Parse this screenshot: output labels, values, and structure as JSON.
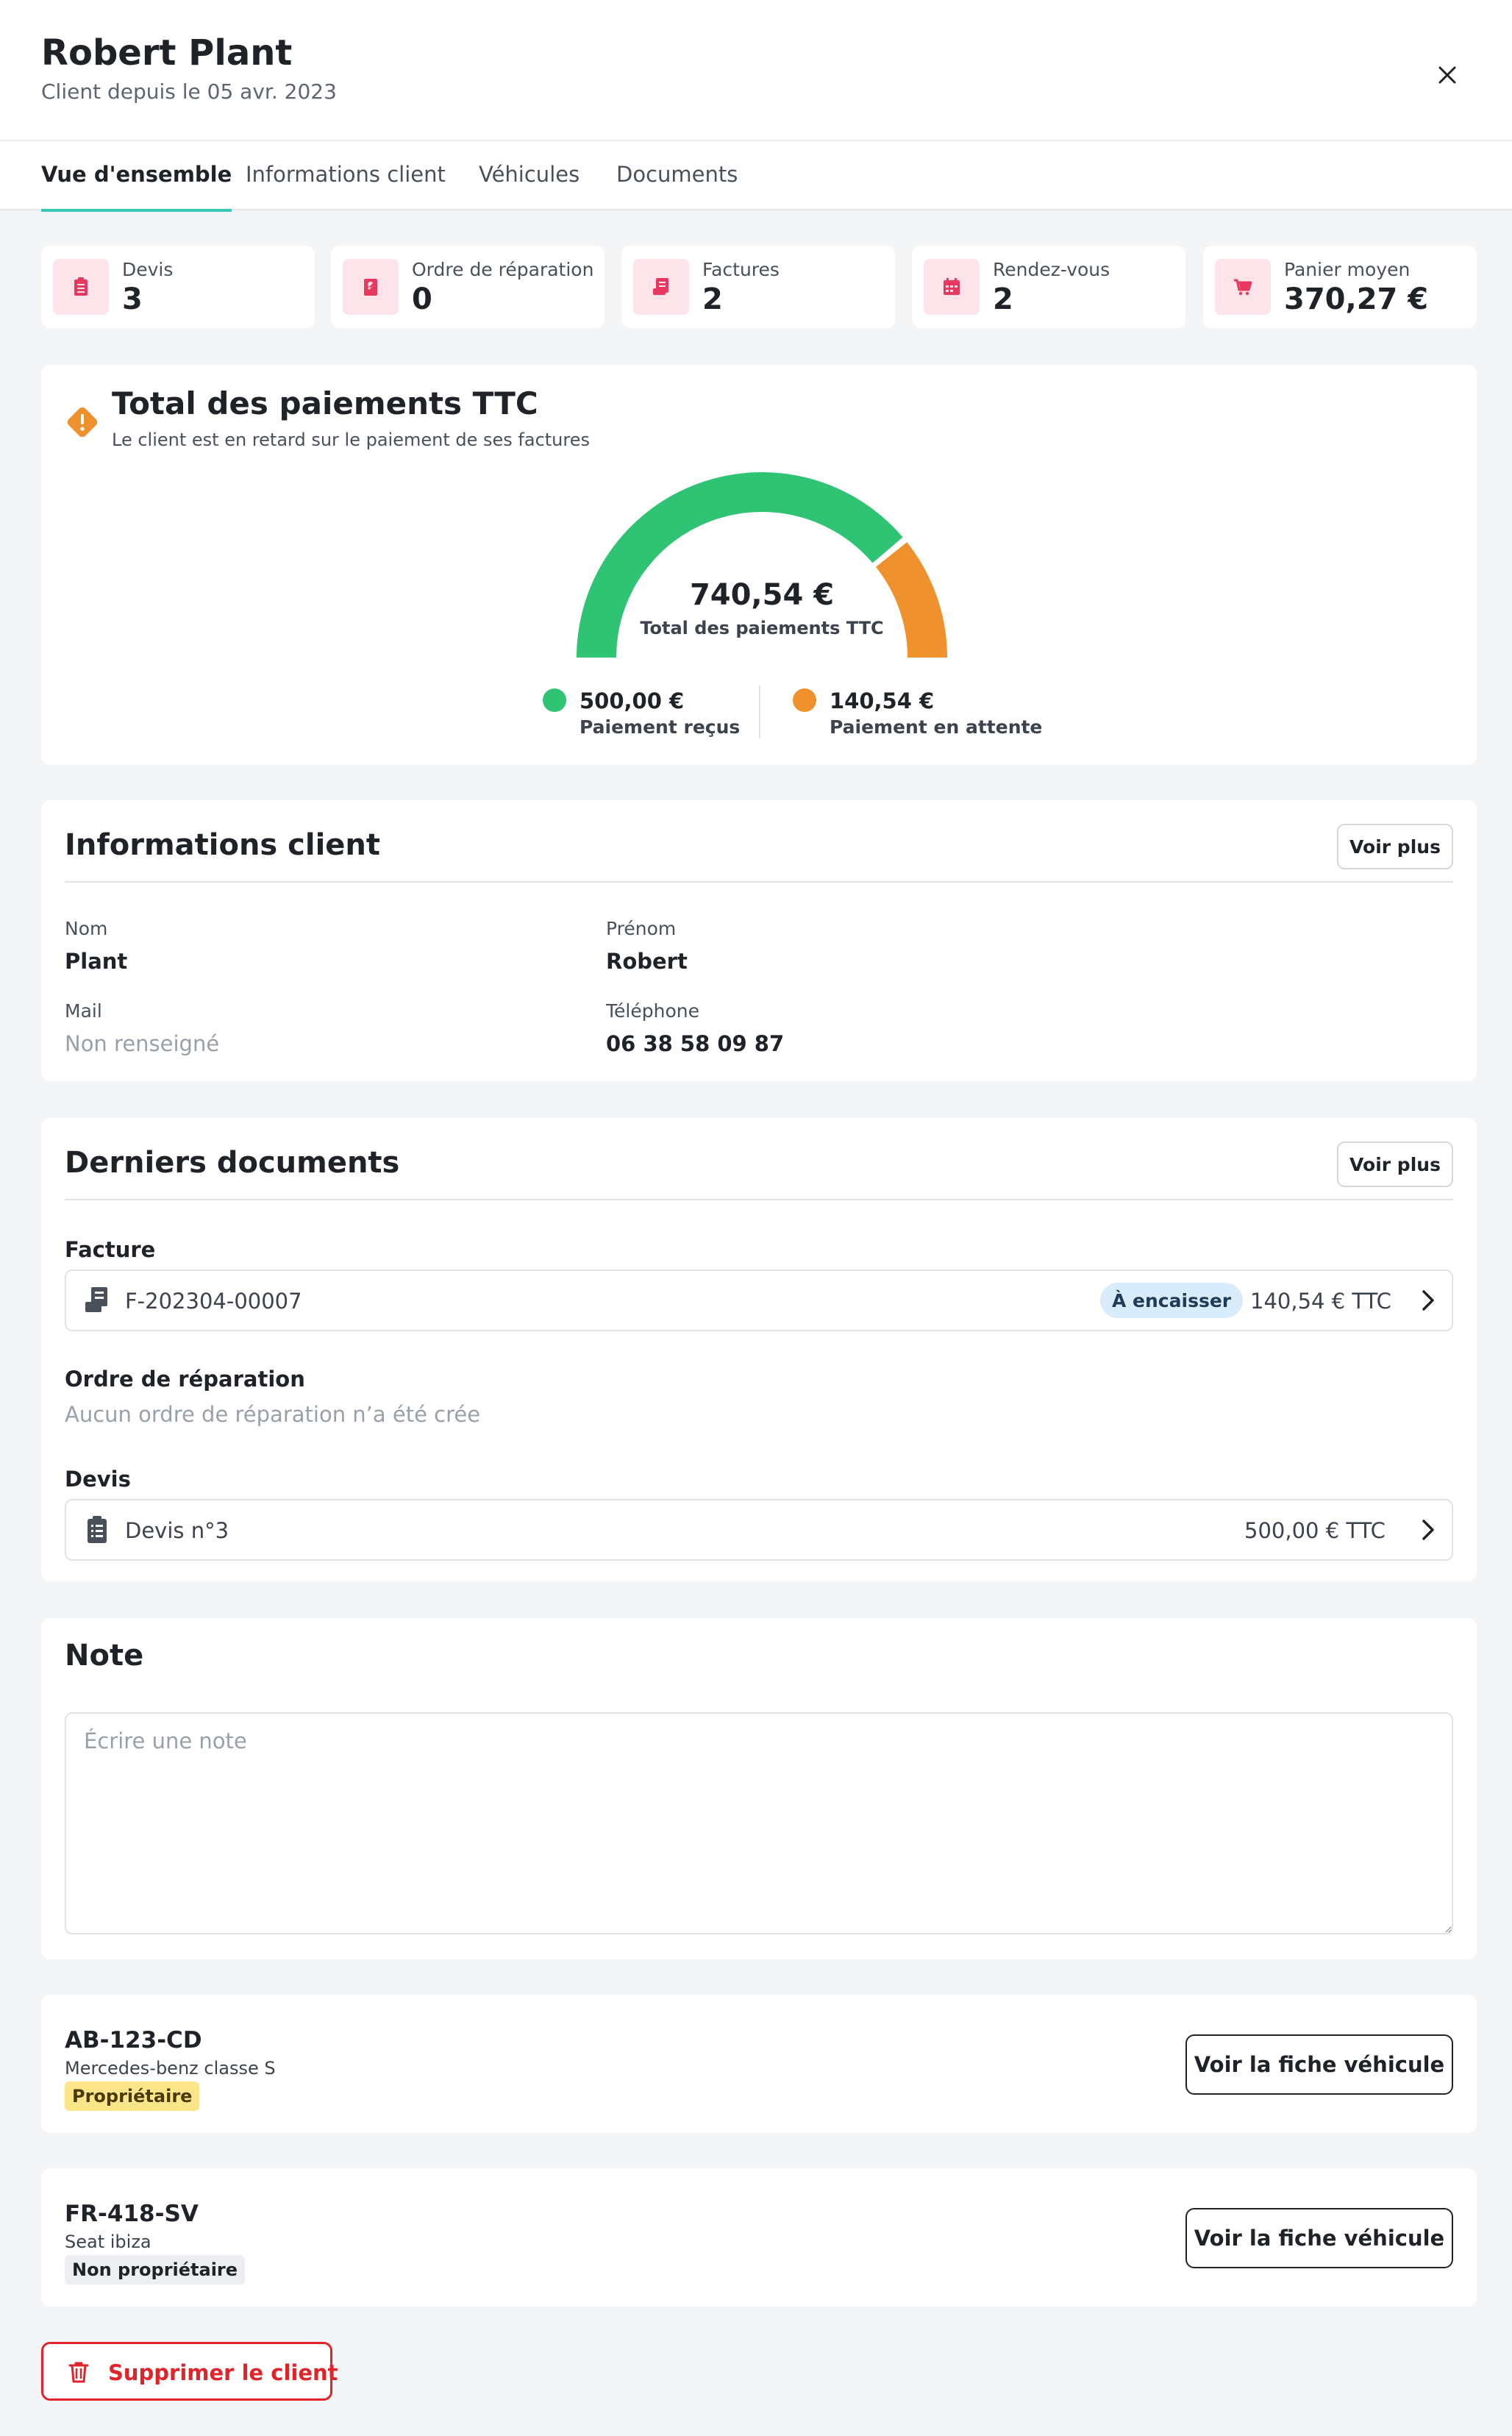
{
  "header": {
    "client_name": "Robert Plant",
    "client_since": "Client depuis le 05 avr. 2023"
  },
  "tabs": [
    {
      "label": "Vue d'ensemble",
      "active": true
    },
    {
      "label": "Informations client",
      "active": false
    },
    {
      "label": "Véhicules",
      "active": false
    },
    {
      "label": "Documents",
      "active": false
    }
  ],
  "stats": [
    {
      "label": "Devis",
      "value": "3",
      "icon": "clipboard-icon"
    },
    {
      "label": "Ordre de réparation",
      "value": "0",
      "icon": "wrench-icon"
    },
    {
      "label": "Factures",
      "value": "2",
      "icon": "invoice-icon"
    },
    {
      "label": "Rendez-vous",
      "value": "2",
      "icon": "calendar-icon"
    },
    {
      "label": "Panier moyen",
      "value": "370,27 €",
      "icon": "cart-icon"
    }
  ],
  "payments": {
    "title": "Total des paiements TTC",
    "subtitle": "Le client est en retard sur le paiement de ses factures",
    "total": "740,54 €",
    "total_label": "Total des paiements TTC",
    "received": {
      "amount": "500,00 €",
      "label": "Paiement reçus",
      "value": 500.0
    },
    "pending": {
      "amount": "140,54 €",
      "label": "Paiement en attente",
      "value": 140.54
    }
  },
  "client_info": {
    "title": "Informations client",
    "see_more": "Voir plus",
    "nom_label": "Nom",
    "nom": "Plant",
    "prenom_label": "Prénom",
    "prenom": "Robert",
    "mail_label": "Mail",
    "mail": "Non renseigné",
    "tel_label": "Téléphone",
    "tel": "06 38 58 09 87"
  },
  "documents": {
    "title": "Derniers documents",
    "see_more": "Voir plus",
    "invoice_section": "Facture",
    "invoice": {
      "name": "F-202304-00007",
      "status": "À encaisser",
      "amount": "140,54 € TTC"
    },
    "repair_section": "Ordre de réparation",
    "repair_empty": "Aucun ordre de réparation n’a été crée",
    "quote_section": "Devis",
    "quote": {
      "name": "Devis n°3",
      "amount": "500,00 € TTC"
    }
  },
  "note": {
    "title": "Note",
    "placeholder": "Écrire une note",
    "value": ""
  },
  "vehicles": [
    {
      "plate": "AB-123-CD",
      "model": "Mercedes-benz classe S",
      "badge": "Propriétaire",
      "button": "Voir la fiche véhicule"
    },
    {
      "plate": "FR-418-SV",
      "model": "Seat ibiza",
      "badge": "Non propriétaire",
      "button": "Voir la fiche véhicule"
    }
  ],
  "delete_label": "Supprimer le client",
  "colors": {
    "accent": "#3dc7b5",
    "received": "#2fc473",
    "pending": "#ef922d",
    "danger": "#e0242a",
    "stat_icon": "#e8385f",
    "owner_badge": "#fde58a",
    "other_badge": "#eceef1"
  }
}
